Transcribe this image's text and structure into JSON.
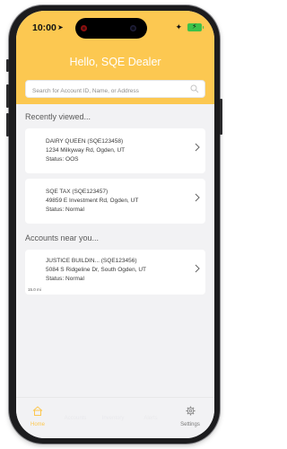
{
  "status_bar": {
    "time": "10:00"
  },
  "header": {
    "greeting": "Hello, SQE Dealer",
    "search_placeholder": "Search for Account ID, Name, or Address"
  },
  "recently_viewed": {
    "title": "Recently viewed...",
    "items": [
      {
        "name": "DAIRY QUEEN (SQE123458)",
        "address": "1234 Milkyway Rd, Ogden, UT",
        "status": "Status: OOS"
      },
      {
        "name": "SQE TAX (SQE123457)",
        "address": "49859 E Investment Rd, Ogden, UT",
        "status": "Status: Normal"
      }
    ]
  },
  "nearby": {
    "title": "Accounts near you...",
    "items": [
      {
        "name": "JUSTICE BUILDIN... (SQE123456)",
        "address": "5084 S Ridgeline Dr, South Ogden, UT",
        "status": "Status: Normal",
        "distance": "15.0 mi"
      }
    ]
  },
  "tabs": [
    {
      "label": "Home"
    },
    {
      "label": "Accounts"
    },
    {
      "label": "Inventory"
    },
    {
      "label": "Alerts"
    },
    {
      "label": "Settings"
    }
  ],
  "colors": {
    "accent": "#fcc851",
    "background": "#f2f2f4",
    "card": "#ffffff"
  }
}
